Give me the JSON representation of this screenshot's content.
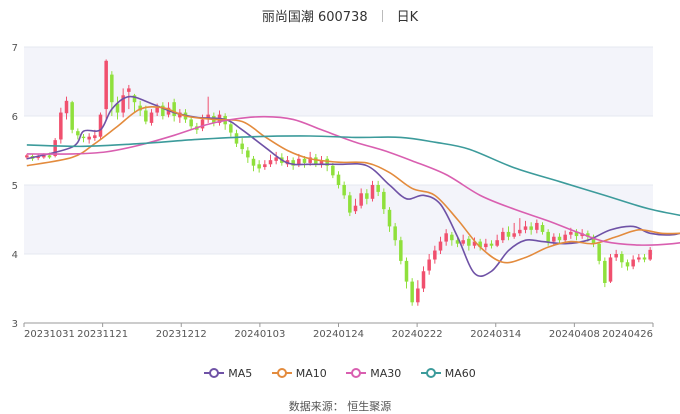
{
  "header": {
    "name": "丽尚国潮 600738",
    "period": "日K"
  },
  "legend": [
    {
      "label": "MA5",
      "color": "#6f52a6"
    },
    {
      "label": "MA10",
      "color": "#e38b3d"
    },
    {
      "label": "MA30",
      "color": "#d95fb0"
    },
    {
      "label": "MA60",
      "color": "#3c9b9b"
    }
  ],
  "source": "数据来源：  恒生聚源",
  "colors": {
    "up": "#f0506e",
    "down": "#8fe03c",
    "band": "#f3f4fa"
  },
  "chart_data": {
    "type": "candlestick",
    "y_ticks": [
      "3",
      "4",
      "5",
      "6",
      "7"
    ],
    "ylim": [
      3,
      7
    ],
    "x_ticks": [
      "20231031",
      "20231121",
      "20231212",
      "20240103",
      "20240124",
      "20240222",
      "20240314",
      "20240408",
      "20240426"
    ],
    "candles": [
      [
        5.4,
        5.43,
        5.45,
        5.37
      ],
      [
        5.42,
        5.38,
        5.45,
        5.35
      ],
      [
        5.39,
        5.41,
        5.44,
        5.36
      ],
      [
        5.4,
        5.44,
        5.46,
        5.38
      ],
      [
        5.43,
        5.4,
        5.47,
        5.38
      ],
      [
        5.42,
        5.65,
        5.68,
        5.4
      ],
      [
        5.66,
        6.05,
        6.12,
        5.6
      ],
      [
        6.04,
        6.22,
        6.28,
        5.95
      ],
      [
        6.2,
        5.8,
        6.22,
        5.75
      ],
      [
        5.78,
        5.72,
        5.82,
        5.66
      ],
      [
        5.7,
        5.68,
        5.74,
        5.62
      ],
      [
        5.66,
        5.7,
        5.75,
        5.6
      ],
      [
        5.68,
        5.72,
        5.8,
        5.64
      ],
      [
        5.7,
        6.02,
        6.05,
        5.66
      ],
      [
        6.1,
        6.8,
        6.82,
        5.95
      ],
      [
        6.6,
        6.2,
        6.65,
        6.0
      ],
      [
        6.18,
        6.05,
        6.28,
        5.95
      ],
      [
        6.05,
        6.3,
        6.4,
        5.98
      ],
      [
        6.35,
        6.4,
        6.45,
        6.1
      ],
      [
        6.3,
        6.2,
        6.32,
        6.05
      ],
      [
        6.15,
        6.08,
        6.22,
        6.0
      ],
      [
        6.08,
        5.92,
        6.15,
        5.88
      ],
      [
        5.9,
        6.05,
        6.1,
        5.86
      ],
      [
        6.05,
        6.12,
        6.18,
        6.0
      ],
      [
        6.15,
        6.0,
        6.2,
        5.95
      ],
      [
        6.02,
        6.12,
        6.2,
        5.98
      ],
      [
        6.2,
        6.0,
        6.25,
        5.92
      ],
      [
        5.98,
        6.05,
        6.1,
        5.9
      ],
      [
        6.05,
        5.95,
        6.1,
        5.9
      ],
      [
        5.95,
        5.85,
        6.0,
        5.8
      ],
      [
        5.85,
        5.8,
        5.9,
        5.74
      ],
      [
        5.82,
        5.95,
        6.02,
        5.78
      ],
      [
        5.95,
        6.02,
        6.28,
        5.9
      ],
      [
        6.0,
        5.9,
        6.05,
        5.85
      ],
      [
        5.9,
        6.02,
        6.08,
        5.86
      ],
      [
        6.0,
        5.88,
        6.04,
        5.8
      ],
      [
        5.88,
        5.76,
        5.92,
        5.7
      ],
      [
        5.75,
        5.6,
        5.8,
        5.55
      ],
      [
        5.6,
        5.52,
        5.68,
        5.45
      ],
      [
        5.5,
        5.4,
        5.55,
        5.32
      ],
      [
        5.38,
        5.28,
        5.42,
        5.2
      ],
      [
        5.3,
        5.24,
        5.36,
        5.18
      ],
      [
        5.26,
        5.3,
        5.36,
        5.22
      ],
      [
        5.3,
        5.36,
        5.44,
        5.26
      ],
      [
        5.35,
        5.4,
        5.48,
        5.3
      ],
      [
        5.4,
        5.32,
        5.46,
        5.28
      ],
      [
        5.3,
        5.36,
        5.42,
        5.26
      ],
      [
        5.36,
        5.28,
        5.4,
        5.22
      ],
      [
        5.3,
        5.38,
        5.45,
        5.26
      ],
      [
        5.38,
        5.32,
        5.42,
        5.25
      ],
      [
        5.32,
        5.4,
        5.48,
        5.28
      ],
      [
        5.4,
        5.3,
        5.45,
        5.26
      ],
      [
        5.3,
        5.36,
        5.42,
        5.25
      ],
      [
        5.38,
        5.28,
        5.42,
        5.2
      ],
      [
        5.28,
        5.14,
        5.32,
        5.1
      ],
      [
        5.15,
        5.0,
        5.2,
        4.95
      ],
      [
        5.0,
        4.85,
        5.05,
        4.8
      ],
      [
        4.85,
        4.6,
        4.9,
        4.55
      ],
      [
        4.62,
        4.7,
        4.8,
        4.58
      ],
      [
        4.7,
        4.88,
        4.95,
        4.66
      ],
      [
        4.88,
        4.8,
        4.94,
        4.72
      ],
      [
        4.8,
        5.0,
        5.06,
        4.76
      ],
      [
        5.0,
        4.9,
        5.06,
        4.84
      ],
      [
        4.9,
        4.65,
        4.95,
        4.58
      ],
      [
        4.64,
        4.4,
        4.68,
        4.32
      ],
      [
        4.4,
        4.2,
        4.45,
        4.12
      ],
      [
        4.2,
        3.9,
        4.25,
        3.85
      ],
      [
        3.9,
        3.6,
        3.95,
        3.5
      ],
      [
        3.6,
        3.3,
        3.65,
        3.25
      ],
      [
        3.3,
        3.5,
        3.62,
        3.25
      ],
      [
        3.5,
        3.75,
        3.82,
        3.45
      ],
      [
        3.76,
        3.92,
        4.0,
        3.7
      ],
      [
        3.92,
        4.05,
        4.12,
        3.86
      ],
      [
        4.05,
        4.18,
        4.25,
        4.0
      ],
      [
        4.18,
        4.3,
        4.36,
        4.12
      ],
      [
        4.28,
        4.2,
        4.32,
        4.12
      ],
      [
        4.2,
        4.15,
        4.25,
        4.1
      ],
      [
        4.15,
        4.2,
        4.28,
        4.12
      ],
      [
        4.22,
        4.12,
        4.26,
        4.05
      ],
      [
        4.12,
        4.18,
        4.24,
        4.08
      ],
      [
        4.18,
        4.1,
        4.22,
        4.05
      ],
      [
        4.1,
        4.15,
        4.22,
        4.05
      ],
      [
        4.15,
        4.12,
        4.2,
        4.08
      ],
      [
        4.12,
        4.2,
        4.28,
        4.1
      ],
      [
        4.2,
        4.32,
        4.38,
        4.16
      ],
      [
        4.32,
        4.25,
        4.4,
        4.2
      ],
      [
        4.25,
        4.3,
        4.45,
        4.22
      ],
      [
        4.3,
        4.35,
        4.52,
        4.26
      ],
      [
        4.35,
        4.4,
        4.48,
        4.3
      ],
      [
        4.4,
        4.35,
        4.46,
        4.28
      ],
      [
        4.35,
        4.45,
        4.5,
        4.3
      ],
      [
        4.42,
        4.32,
        4.46,
        4.28
      ],
      [
        4.32,
        4.18,
        4.36,
        4.12
      ],
      [
        4.18,
        4.25,
        4.3,
        4.12
      ],
      [
        4.25,
        4.2,
        4.3,
        4.15
      ],
      [
        4.2,
        4.28,
        4.34,
        4.16
      ],
      [
        4.28,
        4.32,
        4.38,
        4.22
      ],
      [
        4.32,
        4.26,
        4.36,
        4.2
      ],
      [
        4.26,
        4.3,
        4.36,
        4.22
      ],
      [
        4.3,
        4.25,
        4.34,
        4.18
      ],
      [
        4.25,
        4.15,
        4.28,
        4.1
      ],
      [
        4.15,
        3.9,
        4.18,
        3.85
      ],
      [
        3.9,
        3.58,
        3.95,
        3.52
      ],
      [
        3.6,
        3.95,
        4.0,
        3.58
      ],
      [
        3.95,
        4.0,
        4.06,
        3.9
      ],
      [
        4.0,
        3.88,
        4.04,
        3.8
      ],
      [
        3.88,
        3.82,
        3.92,
        3.76
      ],
      [
        3.82,
        3.92,
        3.98,
        3.78
      ],
      [
        3.92,
        3.95,
        4.0,
        3.88
      ],
      [
        3.95,
        3.92,
        4.0,
        3.88
      ],
      [
        3.92,
        4.06,
        4.1,
        3.9
      ]
    ],
    "series": [
      {
        "name": "MA5",
        "color": "#6f52a6",
        "values": [
          [
            0,
            5.38
          ],
          [
            8,
            5.55
          ],
          [
            10,
            5.78
          ],
          [
            13,
            5.8
          ],
          [
            15,
            6.1
          ],
          [
            18,
            6.28
          ],
          [
            22,
            6.18
          ],
          [
            26,
            6.05
          ],
          [
            30,
            5.98
          ],
          [
            35,
            5.95
          ],
          [
            38,
            5.8
          ],
          [
            42,
            5.55
          ],
          [
            46,
            5.32
          ],
          [
            50,
            5.3
          ],
          [
            55,
            5.3
          ],
          [
            60,
            5.28
          ],
          [
            64,
            5.0
          ],
          [
            67,
            4.8
          ],
          [
            70,
            4.85
          ],
          [
            73,
            4.72
          ],
          [
            76,
            4.25
          ],
          [
            79,
            3.72
          ],
          [
            82,
            3.75
          ],
          [
            85,
            4.05
          ],
          [
            88,
            4.2
          ],
          [
            91,
            4.18
          ],
          [
            95,
            4.15
          ],
          [
            99,
            4.2
          ],
          [
            103,
            4.35
          ],
          [
            107,
            4.4
          ],
          [
            110,
            4.3
          ],
          [
            114,
            4.28
          ],
          [
            118,
            4.35
          ],
          [
            122,
            4.28
          ],
          [
            126,
            3.98
          ],
          [
            130,
            3.92
          ],
          [
            134,
            4.0
          ],
          [
            138,
            3.95
          ]
        ]
      },
      {
        "name": "MA10",
        "color": "#e38b3d",
        "values": [
          [
            0,
            5.28
          ],
          [
            8,
            5.4
          ],
          [
            12,
            5.6
          ],
          [
            16,
            5.85
          ],
          [
            20,
            6.1
          ],
          [
            24,
            6.12
          ],
          [
            28,
            6.0
          ],
          [
            33,
            5.95
          ],
          [
            38,
            5.92
          ],
          [
            42,
            5.7
          ],
          [
            46,
            5.5
          ],
          [
            50,
            5.38
          ],
          [
            55,
            5.33
          ],
          [
            60,
            5.32
          ],
          [
            64,
            5.18
          ],
          [
            68,
            4.95
          ],
          [
            72,
            4.85
          ],
          [
            76,
            4.5
          ],
          [
            80,
            4.1
          ],
          [
            84,
            3.88
          ],
          [
            88,
            3.95
          ],
          [
            92,
            4.1
          ],
          [
            96,
            4.18
          ],
          [
            100,
            4.15
          ],
          [
            104,
            4.25
          ],
          [
            108,
            4.35
          ],
          [
            112,
            4.3
          ],
          [
            116,
            4.3
          ],
          [
            120,
            4.3
          ],
          [
            124,
            4.25
          ],
          [
            128,
            4.1
          ],
          [
            132,
            4.0
          ],
          [
            138,
            3.98
          ]
        ]
      },
      {
        "name": "MA30",
        "color": "#d95fb0",
        "values": [
          [
            0,
            5.45
          ],
          [
            8,
            5.45
          ],
          [
            14,
            5.48
          ],
          [
            20,
            5.58
          ],
          [
            26,
            5.72
          ],
          [
            32,
            5.88
          ],
          [
            37,
            5.96
          ],
          [
            42,
            5.99
          ],
          [
            47,
            5.95
          ],
          [
            52,
            5.8
          ],
          [
            58,
            5.62
          ],
          [
            63,
            5.5
          ],
          [
            68,
            5.35
          ],
          [
            74,
            5.15
          ],
          [
            80,
            4.85
          ],
          [
            86,
            4.65
          ],
          [
            92,
            4.48
          ],
          [
            97,
            4.32
          ],
          [
            102,
            4.18
          ],
          [
            108,
            4.13
          ],
          [
            114,
            4.15
          ],
          [
            120,
            4.22
          ],
          [
            126,
            4.25
          ],
          [
            132,
            4.22
          ],
          [
            138,
            4.18
          ]
        ]
      },
      {
        "name": "MA60",
        "color": "#3c9b9b",
        "values": [
          [
            0,
            5.58
          ],
          [
            10,
            5.56
          ],
          [
            20,
            5.6
          ],
          [
            30,
            5.66
          ],
          [
            40,
            5.7
          ],
          [
            50,
            5.71
          ],
          [
            58,
            5.69
          ],
          [
            66,
            5.69
          ],
          [
            72,
            5.62
          ],
          [
            78,
            5.52
          ],
          [
            86,
            5.25
          ],
          [
            94,
            5.05
          ],
          [
            102,
            4.85
          ],
          [
            110,
            4.65
          ],
          [
            118,
            4.52
          ],
          [
            126,
            4.4
          ],
          [
            132,
            4.28
          ],
          [
            138,
            4.2
          ]
        ]
      }
    ]
  }
}
